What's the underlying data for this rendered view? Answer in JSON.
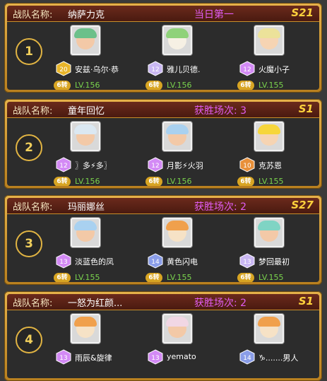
{
  "header_label": "战队名称:",
  "zhuan_label": "6转",
  "teams": [
    {
      "rank": "1",
      "name": "纳萨力克",
      "status": "当日第一",
      "season": "S21",
      "members": [
        {
          "name": "安兹·乌尔·恭",
          "level": "LV.156",
          "badge": "20",
          "badge_color": "#e8b52a",
          "avatar": "green-haired-character",
          "hair": "#6cc08a",
          "skin": "#f3c9a7"
        },
        {
          "name": "雅儿贝德.",
          "level": "LV.156",
          "badge": "12",
          "badge_color": "#c9b7f2",
          "avatar": "sheep-character",
          "hair": "#8fd27a",
          "skin": "#f6f0e4"
        },
        {
          "name": "火魔小子",
          "level": "LV.155",
          "badge": "12",
          "badge_color": "#d38af5",
          "avatar": "blonde-character",
          "hair": "#ece29a",
          "skin": "#f6d4b3"
        }
      ]
    },
    {
      "rank": "2",
      "name": "童年回忆",
      "status": "获胜场次: 3",
      "season": "S1",
      "members": [
        {
          "name": "〗多⚡多〗",
          "level": "LV.156",
          "badge": "12",
          "badge_color": "#d38af5",
          "avatar": "white-haired-character",
          "hair": "#dbe8f2",
          "skin": "#f3c9a7"
        },
        {
          "name": "月影⚡火羽",
          "level": "LV.156",
          "badge": "12",
          "badge_color": "#d38af5",
          "avatar": "blue-haired-character",
          "hair": "#a9d1f0",
          "skin": "#f3c9a7"
        },
        {
          "name": "克苏恩",
          "level": "LV.155",
          "badge": "10",
          "badge_color": "#e8903a",
          "avatar": "yellow-haired-character",
          "hair": "#f6d63b",
          "skin": "#f6d4b3"
        }
      ]
    },
    {
      "rank": "3",
      "name": "玛丽娜丝",
      "status": "获胜场次: 2",
      "season": "S27",
      "members": [
        {
          "name": "淡蓝色的凤",
          "level": "LV.155",
          "badge": "13",
          "badge_color": "#d38af5",
          "avatar": "blue-haired-character",
          "hair": "#a9d1f0",
          "skin": "#f3c9a7"
        },
        {
          "name": "黄色闪电",
          "level": "LV.155",
          "badge": "14",
          "badge_color": "#8a9de8",
          "avatar": "orange-haired-character",
          "hair": "#f0a04c",
          "skin": "#f6e2c6"
        },
        {
          "name": "梦回最初",
          "level": "LV.155",
          "badge": "13",
          "badge_color": "#c9b7f2",
          "avatar": "teal-haired-character",
          "hair": "#7fd4c4",
          "skin": "#f3c9a7"
        }
      ]
    },
    {
      "rank": "4",
      "name": "一怒为红颜...",
      "status": "获胜场次: 2",
      "season": "S1",
      "members": [
        {
          "name": "雨辰&旋律",
          "level": "",
          "badge": "13",
          "badge_color": "#d38af5",
          "avatar": "orange-haired-character",
          "hair": "#f0a04c",
          "skin": "#f6e2c6"
        },
        {
          "name": "yemato",
          "level": "",
          "badge": "13",
          "badge_color": "#d38af5",
          "avatar": "white-haired-character",
          "hair": "#f1d7e4",
          "skin": "#f3c9a7"
        },
        {
          "name": "♑.......男人",
          "level": "",
          "badge": "14",
          "badge_color": "#8a9de8",
          "avatar": "orange-haired-character",
          "hair": "#f0a04c",
          "skin": "#f6e2c6"
        }
      ]
    }
  ]
}
